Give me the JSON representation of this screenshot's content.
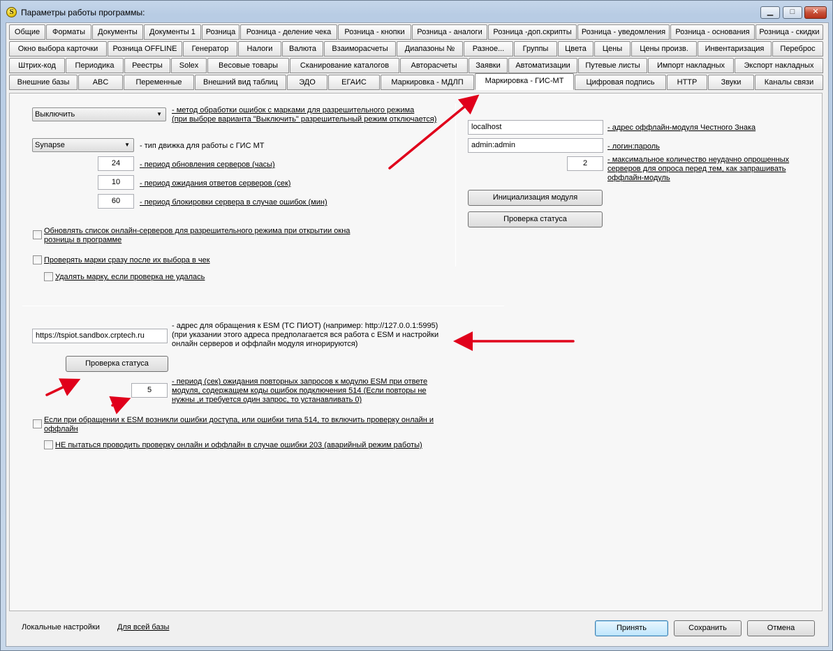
{
  "window": {
    "title": "Параметры работы программы:",
    "app_icon": "S",
    "minimize_glyph": "▁",
    "maximize_glyph": "□",
    "close_glyph": "✕"
  },
  "tabs": {
    "row1": [
      "Общие",
      "Форматы",
      "Документы",
      "Документы 1",
      "Розница",
      "Розница - деление чека",
      "Розница - кнопки",
      "Розница - аналоги",
      "Розница -доп.скрипты",
      "Розница - уведомления",
      "Розница - основания",
      "Розница - скидки"
    ],
    "row2": [
      "Окно выбора карточки",
      "Розница OFFLINE",
      "Генератор",
      "Налоги",
      "Валюта",
      "Взаиморасчеты",
      "Диапазоны №",
      "Разное...",
      "Группы",
      "Цвета",
      "Цены",
      "Цены произв.",
      "Инвентаризация",
      "Переброс"
    ],
    "row3": [
      "Штрих-код",
      "Периодика",
      "Реестры",
      "Solex",
      "Весовые товары",
      "Сканирование каталогов",
      "Авторасчеты",
      "Заявки",
      "Автоматизации",
      "Путевые листы",
      "Импорт накладных",
      "Экспорт накладных"
    ],
    "row4": [
      "Внешние базы",
      "ABC",
      "Переменные",
      "Внешний вид таблиц",
      "ЭДО",
      "ЕГАИС",
      "Маркировка - МДЛП",
      "Маркировка - ГИС-МТ",
      "Цифровая подпись",
      "HTTP",
      "Звуки",
      "Каналы связи"
    ],
    "active": "Маркировка - ГИС-МТ"
  },
  "left": {
    "error_mode": {
      "value": "Выключить",
      "label1": "- метод обработки ошибок с марками для разрешительного режима",
      "label2": "(при выборе варианта \"Выключить\" разрешительный режим отключается)"
    },
    "engine": {
      "value": "Synapse",
      "label": "- тип движка для работы с ГИС МТ"
    },
    "refresh_period": {
      "value": "24",
      "label": "- период обновления серверов (часы)"
    },
    "wait_period": {
      "value": "10",
      "label": "- период ожидания ответов серверов (сек)"
    },
    "block_period": {
      "value": "60",
      "label": "- период блокировки сервера  в случае ошибок (мин)"
    },
    "update_servers_check": {
      "line1": "Обновлять список онлайн-серверов для разрешительного режима при открытии окна",
      "line2": "розницы в программе"
    },
    "check_marks": "Проверять марки сразу после их выбора в чек",
    "delete_mark": "Удалять марку, если проверка не удалась"
  },
  "right": {
    "offline_address": {
      "value": "localhost",
      "label": "- адрес оффлайн-модуля Честного Знака"
    },
    "login": {
      "value": "admin:admin",
      "label": "- логин:пароль"
    },
    "max_failed": {
      "value": "2",
      "line1": "- максимальное количество неудачно опрошенных",
      "line2": "серверов для опроса перед тем,  как запрашивать",
      "line3": "оффлайн-модуль"
    },
    "init_button": "Инициализация модуля",
    "status_button": "Проверка статуса"
  },
  "esm": {
    "address": {
      "value": "https://tspiot.sandbox.crptech.ru",
      "line1": "- адрес для обращения к ESM  (ТС ПИОТ) (например: http://127.0.0.1:5995)",
      "line2": "(при указании этого адреса предполагается вся работа с ESM и настройки",
      "line3": "онлайн серверов и оффлайн модуля игнорируются)"
    },
    "status_button": "Проверка статуса",
    "retry_period": {
      "value": "5",
      "line1": "- период (сек) ожидания повторных запросов к модулю ESM при ответе",
      "line2": "модуля, содержащем коды ошибок подключения 514 (Если повторы не",
      "line3": "нужны ,и требуется один запрос, то устанавливать 0)"
    },
    "access_errors_check": {
      "line1": "Если при обращении к ESM возникли ошибки доступа, или ошибки типа 514, то включить проверку онлайн и",
      "line2": "оффлайн"
    },
    "no_check_203": "НЕ пытаться проводить проверку онлайн и оффлайн в случае  ошибки 203 (аварийный режим работы)"
  },
  "footer": {
    "local_settings": "Локальные настройки",
    "whole_base": "Для всей базы",
    "accept": "Принять",
    "save": "Сохранить",
    "cancel": "Отмена"
  },
  "colors": {
    "annotation_arrow": "#e0001b",
    "active_tab_bg": "#ffffff",
    "window_frame": "#c5d6ea"
  }
}
